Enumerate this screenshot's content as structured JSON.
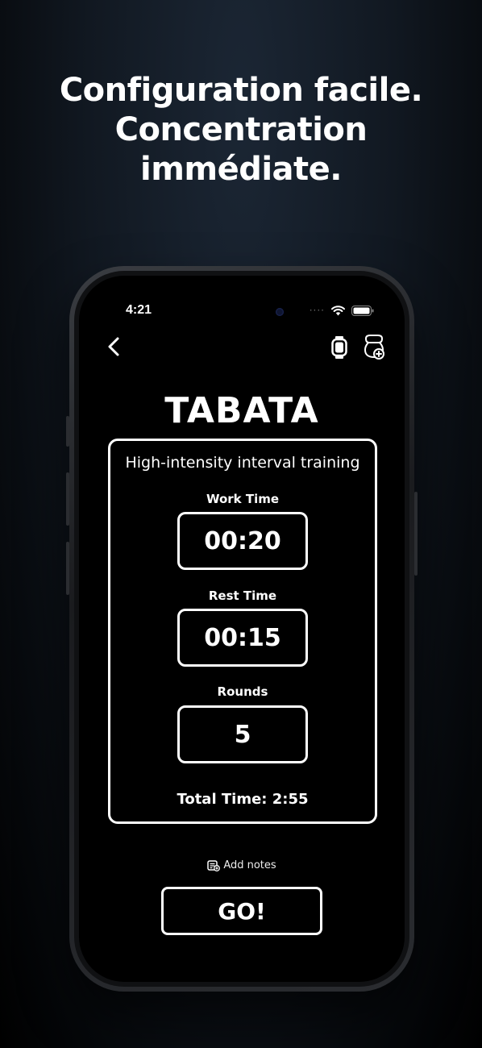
{
  "headline": {
    "line1": "Configuration facile.",
    "line2": "Concentration",
    "line3": "immédiate."
  },
  "status_bar": {
    "time": "4:21",
    "dots": "····"
  },
  "nav": {
    "back_icon": "chevron-left-icon",
    "watch_icon": "watch-icon",
    "kettlebell_icon": "kettlebell-plus-icon"
  },
  "workout": {
    "title": "TABATA",
    "subtitle": "High-intensity interval training",
    "fields": [
      {
        "label": "Work Time",
        "value": "00:20"
      },
      {
        "label": "Rest Time",
        "value": "00:15"
      },
      {
        "label": "Rounds",
        "value": "5"
      }
    ],
    "total": "Total Time: 2:55"
  },
  "notes_label": "Add notes",
  "go_label": "GO!",
  "colors": {
    "background": "#000000",
    "text": "#ffffff",
    "bg_top": "#1b2634"
  }
}
